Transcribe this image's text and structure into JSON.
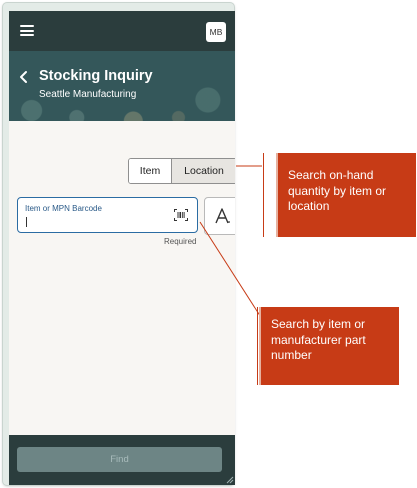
{
  "app": {
    "user_initials": "MB",
    "title": "Stocking Inquiry",
    "subtitle": "Seattle Manufacturing"
  },
  "search_mode": {
    "options": [
      "Item",
      "Location"
    ],
    "selected": "Item"
  },
  "search_field": {
    "label": "Item or MPN Barcode",
    "value": "",
    "required_text": "Required"
  },
  "footer": {
    "find_label": "Find",
    "find_enabled": false
  },
  "callouts": [
    {
      "text": "Search on-hand quantity by item or location"
    },
    {
      "text": "Search by item or manufacturer part number"
    }
  ],
  "colors": {
    "topbar": "#2b3d3d",
    "header": "#34575a",
    "input_border": "#2b6ca3",
    "callout": "#c73b16",
    "find_button": "#6d8585"
  }
}
